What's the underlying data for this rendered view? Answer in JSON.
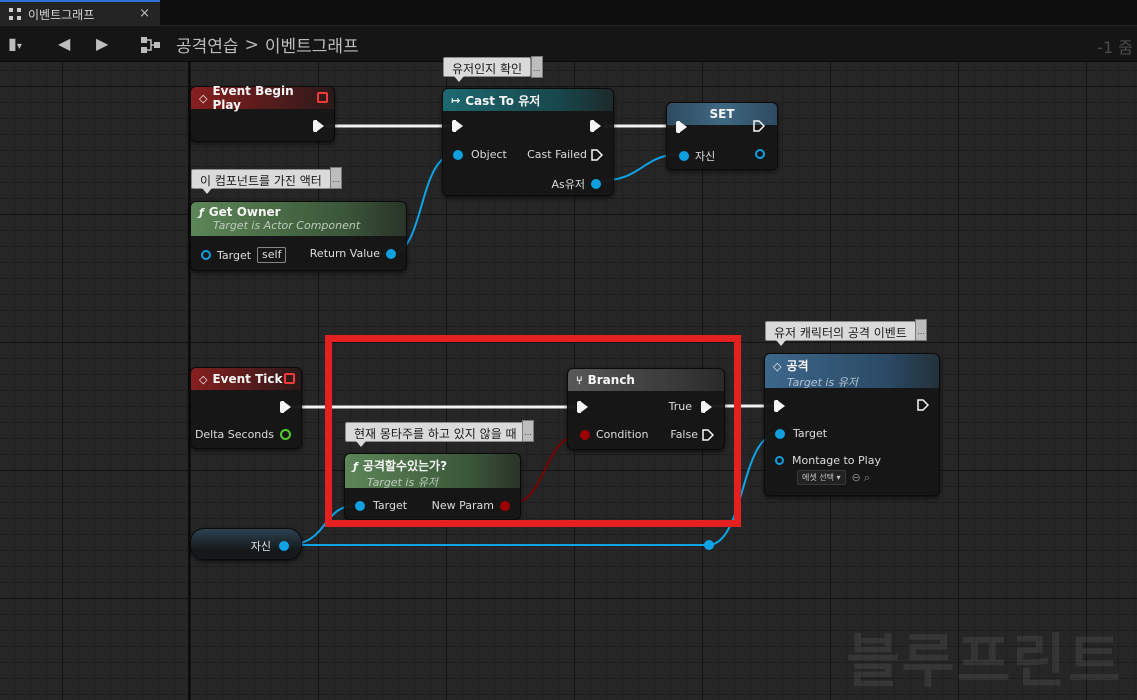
{
  "tab": {
    "title": "이벤트그래프",
    "close": "×"
  },
  "breadcrumb": {
    "root": "공격연습",
    "separator": ">",
    "current": "이벤트그래프"
  },
  "zoom_label": "-1 줌",
  "comments": {
    "cast": "유저인지 확인",
    "owner": "이 컴포넌트를 가진 액터",
    "attack_event": "유저 캐릭터의 공격 이벤트",
    "can_attack": "현재 몽타주를 하고 있지 않을 때"
  },
  "nodes": {
    "begin_play": {
      "title": "Event Begin Play"
    },
    "cast": {
      "title": "Cast To 유저",
      "pin_object": "Object",
      "pin_failed": "Cast Failed",
      "pin_as": "As유저"
    },
    "set": {
      "title": "SET",
      "pin_var": "자신"
    },
    "get_owner": {
      "title": "Get Owner",
      "subtitle": "Target is Actor Component",
      "pin_target": "Target",
      "target_value": "self",
      "pin_return": "Return Value"
    },
    "event_tick": {
      "title": "Event Tick",
      "pin_delta": "Delta Seconds"
    },
    "branch": {
      "title": "Branch",
      "pin_condition": "Condition",
      "pin_true": "True",
      "pin_false": "False"
    },
    "can_attack": {
      "title": "공격할수있는가?",
      "subtitle": "Target is 유저",
      "pin_target": "Target",
      "pin_param": "New Param"
    },
    "attack": {
      "title": "공격",
      "subtitle": "Target is 유저",
      "pin_target": "Target",
      "pin_montage": "Montage to Play",
      "montage_value": "에셋 선택 ▾"
    },
    "self_var": {
      "label": "자신"
    }
  },
  "watermark": "블루프린트",
  "colors": {
    "exec": "#ffffff",
    "object_pin": "#0fa3e6",
    "bool_pin": "#a20000",
    "float_pin": "#55d12c",
    "highlight": "#e52020"
  }
}
